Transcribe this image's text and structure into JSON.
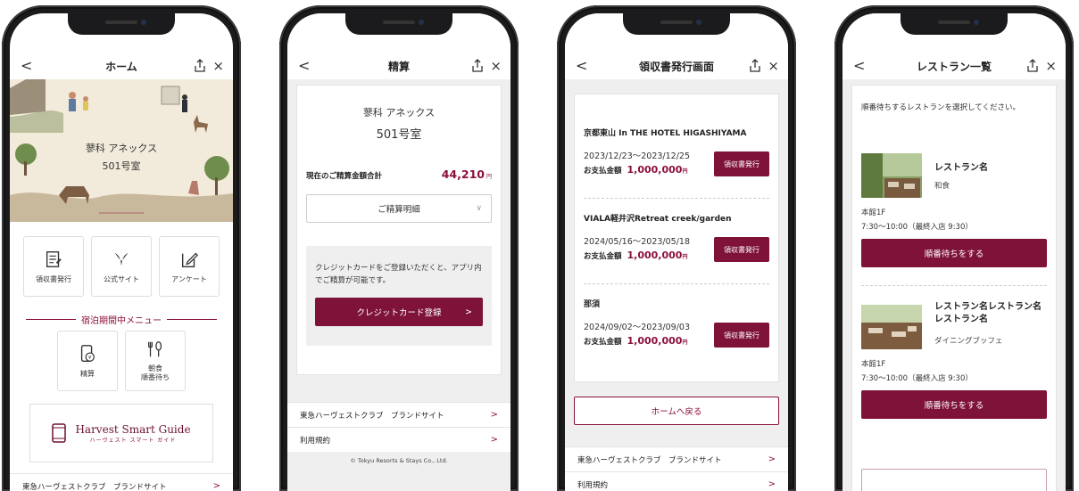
{
  "colors": {
    "brand": "#7e1239",
    "accent_text": "#8b0f3e",
    "hero_bg": "#f2ebdb",
    "gray_bg": "#efefef"
  },
  "phone1": {
    "nav": {
      "back": "<",
      "title": "ホーム",
      "close": "×"
    },
    "hero": {
      "hotel": "蓼科 アネックス",
      "room": "501号室"
    },
    "tiles": [
      {
        "label": "領収書発行",
        "icon": "receipt-icon"
      },
      {
        "label": "公式サイト",
        "icon": "brand-logo-icon"
      },
      {
        "label": "アンケート",
        "icon": "survey-icon"
      }
    ],
    "menu_title": "宿泊期間中メニュー",
    "menu_tiles": [
      {
        "label": "精算",
        "icon": "checkout-icon"
      },
      {
        "label_line1": "朝食",
        "label_line2": "順番待ち",
        "icon": "fork-knife-icon"
      }
    ],
    "guide": {
      "title": "Harvest Smart Guide",
      "subtitle": "ハーヴェスト スマート ガイド"
    },
    "link": {
      "label": "東急ハーヴェストクラブ　ブランドサイト",
      "chevron": ">"
    }
  },
  "phone2": {
    "nav": {
      "back": "<",
      "title": "精算",
      "close": "×"
    },
    "hotel": "蓼科 アネックス",
    "room": "501号室",
    "total_label": "現在のご精算金額合計",
    "total_amount": "44,210",
    "yen": "円",
    "detail_label": "ご精算明細",
    "detail_caret": "∨",
    "notice": "クレジットカードをご登録いただくと、アプリ内でご精算が可能です。",
    "register_button": "クレジットカード登録",
    "register_chevron": ">",
    "links": [
      {
        "label": "東急ハーヴェストクラブ　ブランドサイト",
        "chevron": ">"
      },
      {
        "label": "利用規約",
        "chevron": ">"
      }
    ],
    "copyright": "© Tokyu Resorts & Stays Co., Ltd."
  },
  "phone3": {
    "nav": {
      "back": "<",
      "title": "領収書発行画面",
      "close": "×"
    },
    "receipts": [
      {
        "hotel": "京都東山 In THE HOTEL HIGASHIYAMA",
        "dates": "2023/12/23〜2023/12/25",
        "pay_label": "お支払金額",
        "amount": "1,000,000",
        "yen": "円",
        "button": "領収書発行"
      },
      {
        "hotel": "VIALA軽井沢Retreat creek/garden",
        "dates": "2024/05/16〜2023/05/18",
        "pay_label": "お支払金額",
        "amount": "1,000,000",
        "yen": "円",
        "button": "領収書発行"
      },
      {
        "hotel": "那須",
        "dates": "2024/09/02〜2023/09/03",
        "pay_label": "お支払金額",
        "amount": "1,000,000",
        "yen": "円",
        "button": "領収書発行"
      }
    ],
    "home_button": "ホームへ戻る",
    "links": [
      {
        "label": "東急ハーヴェストクラブ　ブランドサイト",
        "chevron": ">"
      },
      {
        "label": "利用規約",
        "chevron": ">"
      }
    ]
  },
  "phone4": {
    "nav": {
      "back": "<",
      "title": "レストラン一覧",
      "close": "×"
    },
    "instruction": "順番待ちするレストランを選択してください。",
    "restaurants": [
      {
        "name": "レストラン名",
        "genre": "和食",
        "floor": "本館1F",
        "hours": "7:30〜10:00（最終入店 9:30）",
        "button": "順番待ちをする"
      },
      {
        "name": "レストラン名レストラン名レストラン名",
        "genre": "ダイニングブッフェ",
        "floor": "本館1F",
        "hours": "7:30〜10:00（最終入店 9:30）",
        "button": "順番待ちをする"
      }
    ]
  }
}
